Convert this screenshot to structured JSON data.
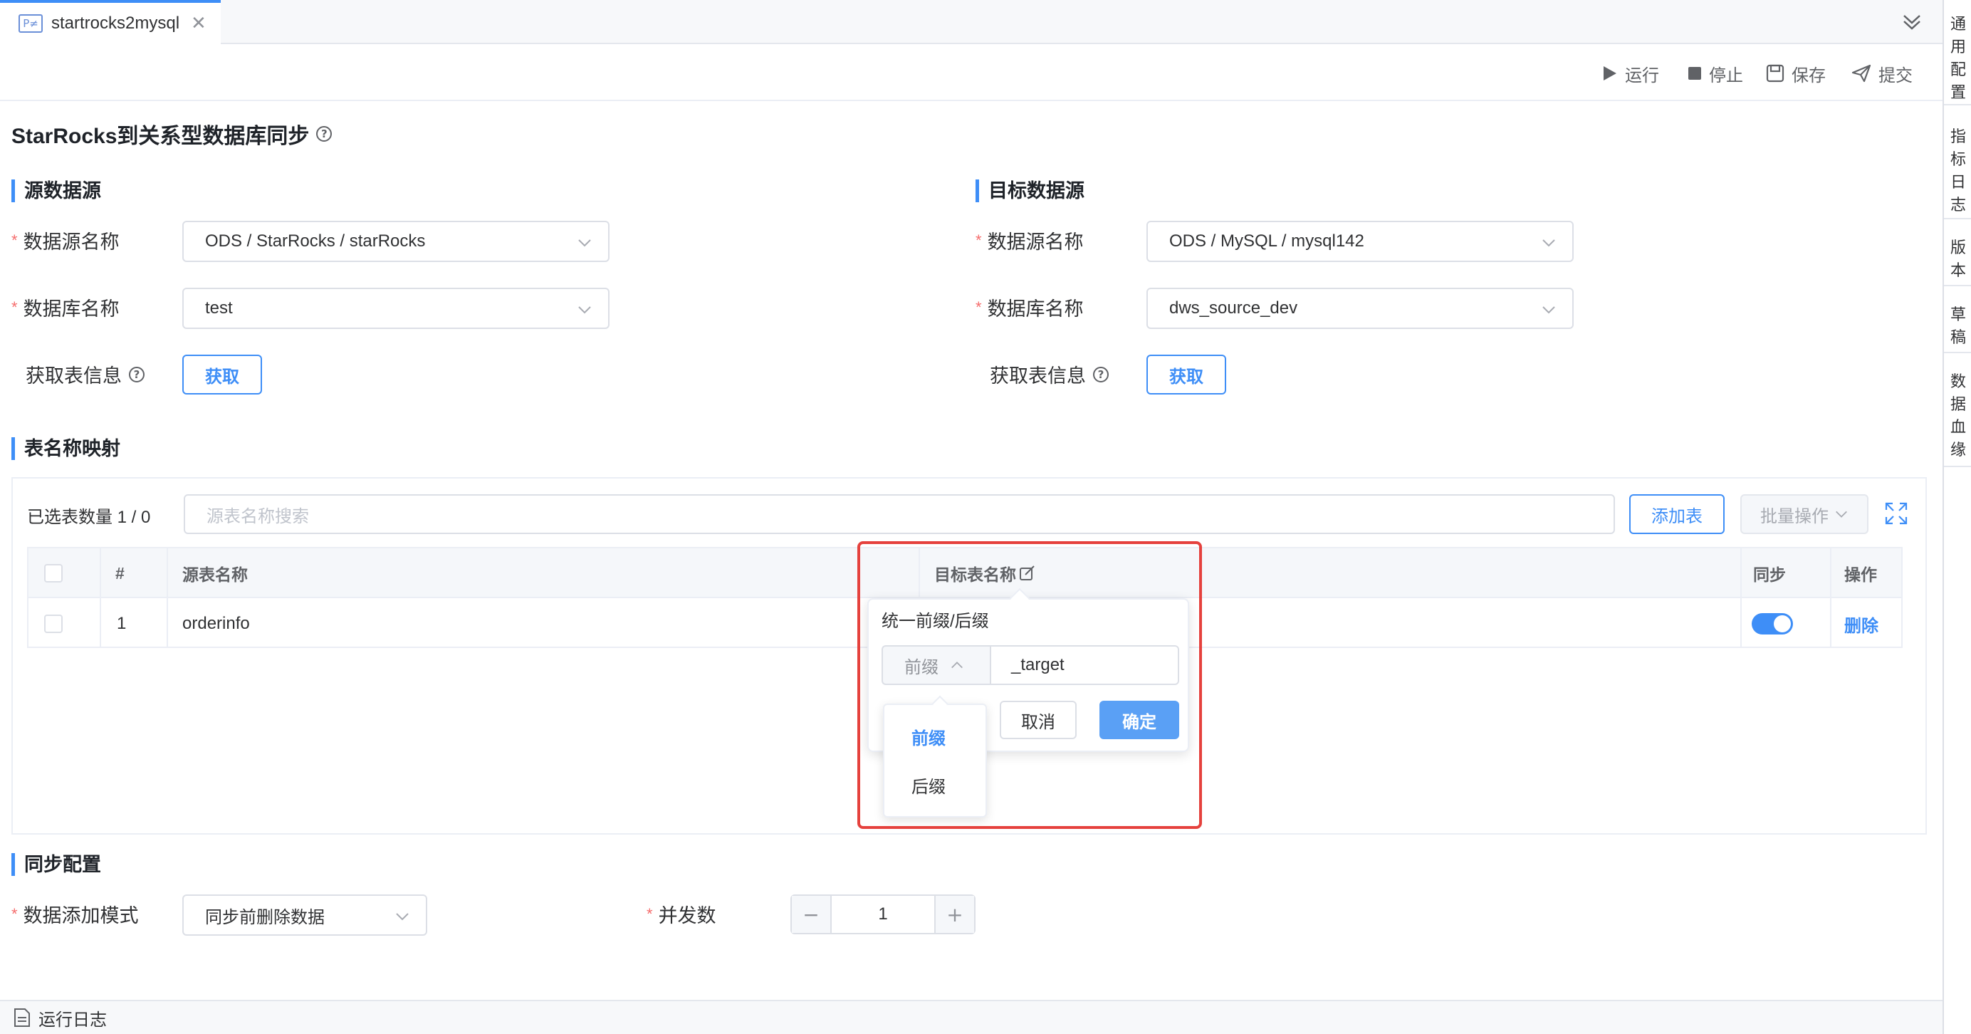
{
  "tab": {
    "icon_text": "P≠",
    "title": "startrocks2mysql"
  },
  "right_sidebar": [
    "通用配置",
    "指标日志",
    "版本",
    "草稿",
    "数据血缘"
  ],
  "toolbar": {
    "run": "运行",
    "stop": "停止",
    "save": "保存",
    "submit": "提交"
  },
  "page_title": "StarRocks到关系型数据库同步",
  "source": {
    "section": "源数据源",
    "datasource_label": "数据源名称",
    "datasource_value": "ODS / StarRocks / starRocks",
    "database_label": "数据库名称",
    "database_value": "test",
    "fetch_label": "获取表信息",
    "fetch_button": "获取"
  },
  "target": {
    "section": "目标数据源",
    "datasource_label": "数据源名称",
    "datasource_value": "ODS / MySQL / mysql142",
    "database_label": "数据库名称",
    "database_value": "dws_source_dev",
    "fetch_label": "获取表信息",
    "fetch_button": "获取"
  },
  "mapping": {
    "section": "表名称映射",
    "selected_count": "已选表数量 1 / 0",
    "search_placeholder": "源表名称搜索",
    "add_table": "添加表",
    "batch_ops": "批量操作",
    "columns": {
      "index": "#",
      "source": "源表名称",
      "target": "目标表名称",
      "sync": "同步",
      "action": "操作"
    },
    "rows": [
      {
        "index": "1",
        "source": "orderinfo",
        "sync": true,
        "action": "删除"
      }
    ]
  },
  "popover": {
    "title": "统一前缀/后缀",
    "mode_value": "前缀",
    "suffix_value": "_target",
    "cancel": "取消",
    "confirm": "确定",
    "options": [
      "前缀",
      "后缀"
    ],
    "selected_option": "前缀"
  },
  "sync_config": {
    "section": "同步配置",
    "mode_label": "数据添加模式",
    "mode_value": "同步前删除数据",
    "concurrency_label": "并发数",
    "concurrency_value": "1",
    "minus": "−",
    "plus": "+"
  },
  "log_bar": {
    "label": "运行日志"
  },
  "colors": {
    "primary": "#3e8ef7",
    "required": "#f56c6c",
    "highlight": "#e5413d"
  }
}
